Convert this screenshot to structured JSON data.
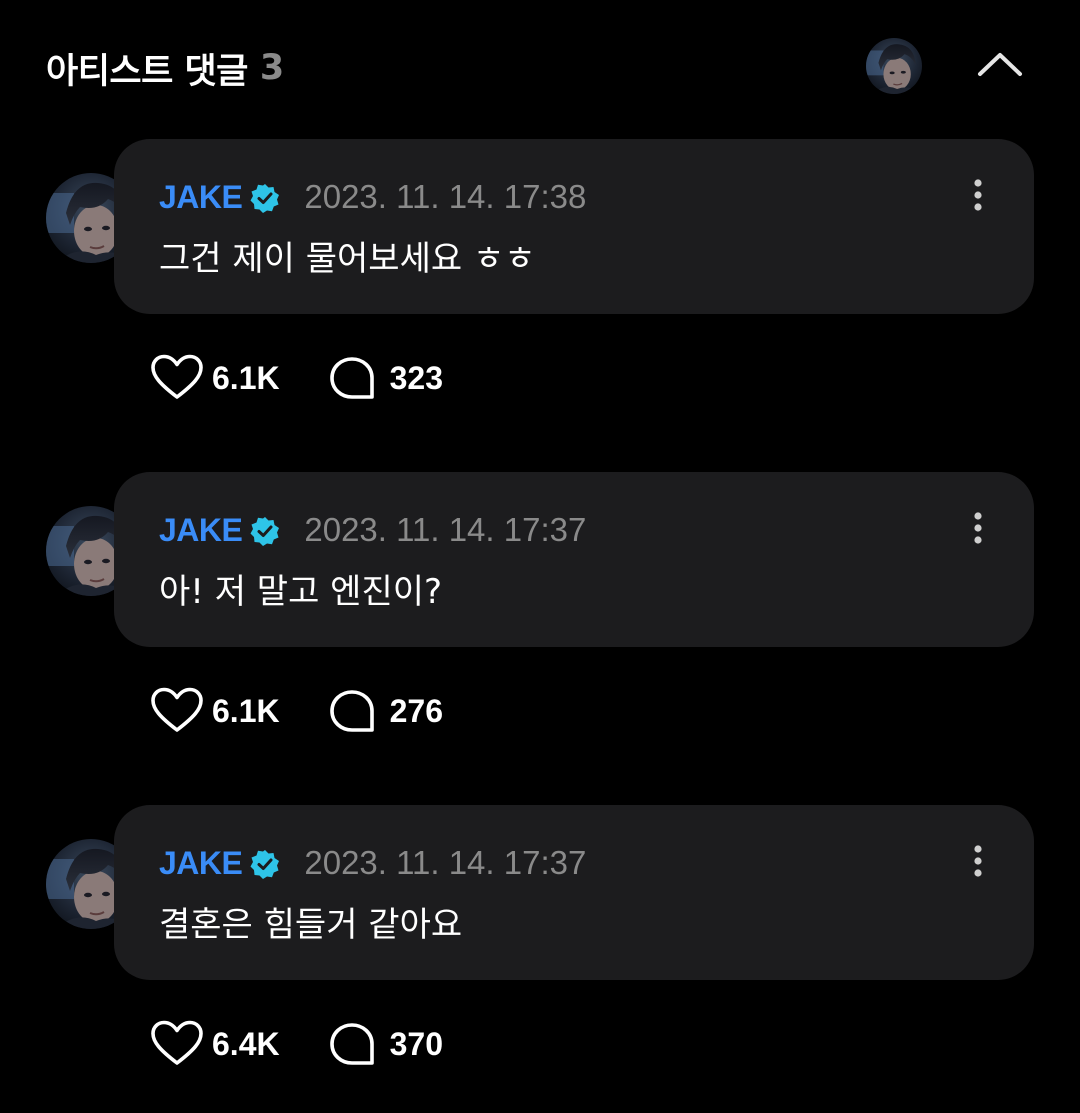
{
  "header": {
    "title": "아티스트 댓글",
    "count": "3",
    "avatar_icon": "artist-avatar",
    "collapse_icon": "chevron-up-icon"
  },
  "colors": {
    "background": "#000000",
    "bubble": "#1c1c1e",
    "author": "#3a8cf7",
    "verified": "#2ec4e8",
    "muted": "#8a8a8a"
  },
  "comments": [
    {
      "author": "JAKE",
      "timestamp": "2023. 11. 14. 17:38",
      "text": "그건 제이 물어보세요 ㅎㅎ",
      "likes": "6.1K",
      "replies": "323"
    },
    {
      "author": "JAKE",
      "timestamp": "2023. 11. 14. 17:37",
      "text": "아! 저 말고 엔진이?",
      "likes": "6.1K",
      "replies": "276"
    },
    {
      "author": "JAKE",
      "timestamp": "2023. 11. 14. 17:37",
      "text": "결혼은 힘들거 같아요",
      "likes": "6.4K",
      "replies": "370"
    }
  ]
}
